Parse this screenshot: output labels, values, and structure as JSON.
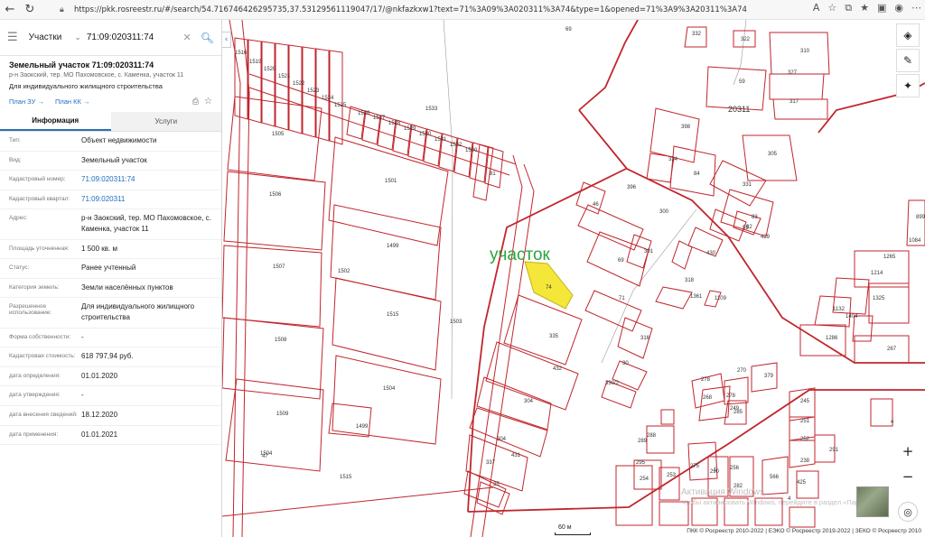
{
  "browser": {
    "url": "https://pkk.rosreestr.ru/#/search/54.716746426295735,37.53129561119047/17/@nkfazkxw1?text=71%3A09%3A020311%3A74&type=1&opened=71%3A9%3A20311%3A74"
  },
  "search": {
    "type_label": "Участки",
    "query": "71:09:020311:74"
  },
  "object": {
    "title": "Земельный участок 71:09:020311:74",
    "address_short": "р-н Заокский, тер. МО Пахомовское, с. Каменка, участок 11",
    "use_short": "Для индивидуального жилищного строительства",
    "link_plan_zu": "План ЗУ →",
    "link_plan_kk": "План КК →"
  },
  "tabs": {
    "info": "Информация",
    "services": "Услуги"
  },
  "attributes": [
    {
      "k": "Тип:",
      "v": "Объект недвижимости"
    },
    {
      "k": "Вид:",
      "v": "Земельный участок"
    },
    {
      "k": "Кадастровый номер:",
      "v": "71:09:020311:74"
    },
    {
      "k": "Кадастровый квартал:",
      "v": "71:09:020311"
    },
    {
      "k": "Адрес:",
      "v": "р-н Заокский, тер. МО Пахомовское, с. Каменка, участок 11"
    },
    {
      "k": "Площадь уточненная:",
      "v": "1 500 кв. м"
    },
    {
      "k": "Статус:",
      "v": "Ранее учтенный"
    },
    {
      "k": "Категория земель:",
      "v": "Земли населённых пунктов"
    },
    {
      "k": "Разрешенное использование:",
      "v": "Для индивидуального жилищного строительства"
    },
    {
      "k": "Форма собственности:",
      "v": "-"
    },
    {
      "k": "Кадастровая стоимость:",
      "v": "618 797,94 руб."
    },
    {
      "k": "дата определения:",
      "v": "01.01.2020"
    },
    {
      "k": "дата утверждения:",
      "v": "-"
    },
    {
      "k": "дата внесения сведений:",
      "v": "18.12.2020"
    },
    {
      "k": "дата применения:",
      "v": "01.01.2021"
    }
  ],
  "map": {
    "annotation": "участок",
    "selected_parcel": "74",
    "quarter_label": "20311",
    "scale_label": "60 м",
    "credits": "ПКК © Росреестр 2010-2022 | ЕЭКО © Росреестр 2019-2022 | ЗЕКО © Росреестр 2010",
    "watermark_line1": "Активация Windows",
    "watermark_line2": "Чтобы активировать Windows, перейдите в раздел «Параметры».",
    "parcel_labels": [
      "69",
      "1516",
      "1519",
      "1520",
      "1521",
      "1522",
      "1523",
      "1524",
      "1525",
      "1526",
      "1527",
      "1528",
      "1529",
      "1530",
      "1531",
      "1532",
      "1500",
      "81",
      "1533",
      "1505",
      "1501",
      "1506",
      "1499",
      "1502",
      "1507",
      "1515",
      "1503",
      "1508",
      "1504",
      "1509",
      "1499",
      "1515",
      "1504",
      "47",
      "46",
      "396",
      "300",
      "69",
      "301",
      "71",
      "335",
      "316",
      "30",
      "330/2",
      "432",
      "304",
      "304",
      "431",
      "337",
      "25",
      "332",
      "322",
      "310",
      "327",
      "59",
      "317",
      "398",
      "334",
      "84",
      "305",
      "331",
      "83",
      "82",
      "55",
      "429",
      "430",
      "318",
      "1361",
      "1109",
      "899",
      "1084",
      "1265",
      "1214",
      "1325",
      "1132",
      "1404",
      "1286",
      "267",
      "270",
      "379",
      "278",
      "278",
      "268",
      "285",
      "249",
      "245",
      "251",
      "252",
      "238",
      "291",
      "289",
      "288",
      "295",
      "275",
      "290",
      "256",
      "566",
      "425",
      "282",
      "254",
      "253",
      "4",
      "1",
      "4"
    ]
  },
  "colors": {
    "parcel_stroke": "#c0262d",
    "highlight_fill": "#f5e63a",
    "annotation_green": "#2aa53a",
    "link_blue": "#1d6fbf"
  }
}
